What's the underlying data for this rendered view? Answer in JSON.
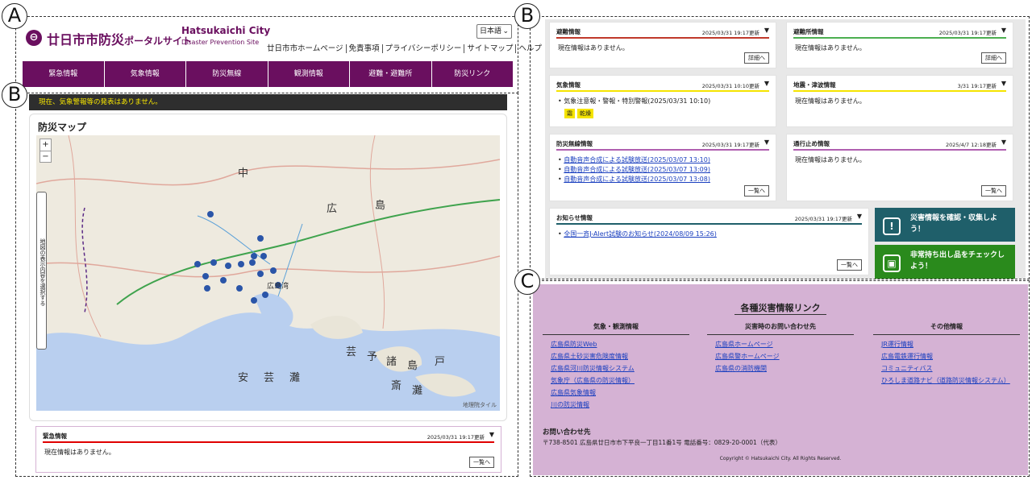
{
  "markers": {
    "a": "A",
    "b1": "B",
    "b2": "B",
    "c": "C"
  },
  "header": {
    "logo_mark": "⊖",
    "title": "廿日市市防災",
    "title_small": "ポータルサイト",
    "en_line1": "Hatsukaichi City",
    "en_line2": "Disaster Prevention Site",
    "lang_select": "日本語",
    "top_links": [
      "廿日市市ホームページ",
      "免責事項",
      "プライバシーポリシー",
      "サイトマップ",
      "ヘルプ"
    ]
  },
  "nav": [
    "緊急情報",
    "気象情報",
    "防災無線",
    "観測情報",
    "避難・避難所",
    "防災リンク"
  ],
  "alert_text": "現在、気象警報等の発表はありません。",
  "map": {
    "title": "防災マップ",
    "zoom_in": "+",
    "zoom_out": "−",
    "side_tab": "地図の表示内容を選択する",
    "credit": "地理院タイル",
    "labels": [
      "中",
      "広",
      "島",
      "広島湾",
      "安",
      "芸",
      "灘",
      "芸",
      "予",
      "諸",
      "島",
      "斎",
      "灘",
      "戸"
    ]
  },
  "emergency": {
    "title": "緊急情報",
    "date": "2025/03/31 19:17更新",
    "body": "現在情報はありません。",
    "button": "一覧へ"
  },
  "panels": {
    "evac": {
      "title": "避難情報",
      "date": "2025/03/31 19:17更新",
      "body": "現在情報はありません。",
      "button": "詳細へ",
      "color": "#c0392b"
    },
    "shelter": {
      "title": "避難所情報",
      "date": "2025/03/31 19:17更新",
      "body": "現在情報はありません。",
      "button": "詳細へ",
      "color": "#4caf50"
    },
    "weather": {
      "title": "気象情報",
      "date": "2025/03/31 10:10更新",
      "item": "気象注意報・警報・特別警報(2025/03/31 10:10)",
      "tags": [
        "霜",
        "乾燥"
      ],
      "color": "#f5e400"
    },
    "quake": {
      "title": "地震・津波情報",
      "date": "3/31 19:17更新",
      "body": "現在情報はありません。",
      "color": "#f5e400"
    },
    "radio": {
      "title": "防災無線情報",
      "date": "2025/03/31 19:17更新",
      "items": [
        "自動音声合成による試験放送(2025/03/07 13:10)",
        "自動音声合成による試験放送(2025/03/07 13:09)",
        "自動音声合成による試験放送(2025/03/07 13:08)"
      ],
      "button": "一覧へ",
      "color": "#b05fb0"
    },
    "road": {
      "title": "通行止め情報",
      "date": "2025/4/7 12:18更新",
      "body": "現在情報はありません。",
      "button": "一覧へ",
      "color": "#b05fb0"
    },
    "notice": {
      "title": "お知らせ情報",
      "date": "2025/03/31 19:17更新",
      "item": "全国一斉J-Alert試験のお知らせ(2024/08/09 15:26)",
      "button": "一覧へ",
      "color": "#1f5f6a"
    }
  },
  "cta": {
    "collect": {
      "label": "災害情報を確認・収集しよう！",
      "color": "#1f5f6a"
    },
    "carry": {
      "label": "非常持ち出し品をチェックしよう！",
      "color": "#2a8a1c"
    }
  },
  "links": {
    "heading": "各種災害情報リンク",
    "columns": [
      {
        "title": "気象・観測情報",
        "items": [
          "広島県防災Web",
          "広島県土砂災害危険度情報",
          "広島県河川防災情報システム",
          "気象庁（広島県の防災情報）",
          "広島県気象情報",
          "川の防災情報"
        ]
      },
      {
        "title": "災害時のお問い合わせ先",
        "items": [
          "広島県ホームページ",
          "広島県警ホームページ",
          "広島県の消防機関"
        ]
      },
      {
        "title": "その他情報",
        "items": [
          "JR運行情報",
          "広島電鉄運行情報",
          "コミュニティバス",
          "ひろしま道路ナビ（道路防災情報システム）"
        ]
      }
    ],
    "contact_heading": "お問い合わせ先",
    "contact_text": "〒738-8501 広島県廿日市市下平良一丁目11番1号 電話番号：0829-20-0001（代表）",
    "copyright": "Copyright © Hatsukaichi City. All Rights Reserved."
  }
}
